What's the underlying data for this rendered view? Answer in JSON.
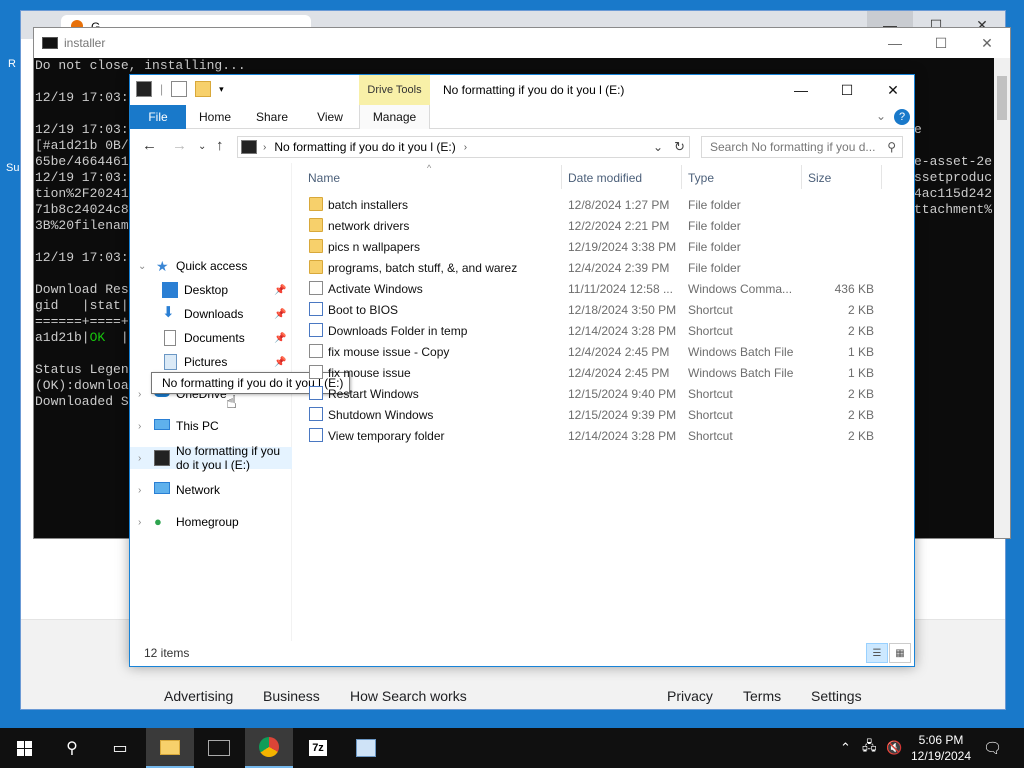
{
  "desktop": {
    "left_letters": [
      "R",
      "S",
      "I",
      "Su"
    ]
  },
  "browser": {
    "tab_title": "G",
    "footer_links_left": [
      "Advertising",
      "Business",
      "How Search works"
    ],
    "footer_links_right": [
      "Privacy",
      "Terms",
      "Settings"
    ]
  },
  "console": {
    "title": "installer",
    "lines": [
      "Do not close, installing...",
      "",
      "12/19 17:03:",
      "",
      "12/19 17:03:",
      "[#a1d21b 0B/",
      "65be/4664461",
      "12/19 17:03:",
      "tion%2F20241",
      "71b8c24024c8",
      "3B%20filenam",
      "",
      "12/19 17:03:",
      "",
      "Download Res",
      "gid   |stat|",
      "======+====+",
      "a1d21b|OK  |",
      "",
      "Status Legen",
      "(OK):downloa",
      "Downloaded S"
    ],
    "right_lines": [
      "",
      "",
      "",
      "",
      "e",
      "",
      "e-asset-2e",
      "ssetproduc",
      "4ac115d242",
      "ttachment%"
    ]
  },
  "explorer": {
    "title": "No formatting if you do it you l (E:)",
    "drive_tools": "Drive Tools",
    "ribbon_tabs": [
      "File",
      "Home",
      "Share",
      "View",
      "Manage"
    ],
    "address_crumb": "No formatting if you do it you l (E:)",
    "search_placeholder": "Search No formatting if you d...",
    "nav": {
      "quick_access": "Quick access",
      "quick_items": [
        "Desktop",
        "Downloads",
        "Documents",
        "Pictures"
      ],
      "onedrive": "OneDrive",
      "this_pc": "This PC",
      "drive": "No formatting if you do it you l (E:)",
      "network": "Network",
      "homegroup": "Homegroup"
    },
    "tooltip": "No formatting if you do it you l (E:)",
    "columns": [
      "Name",
      "Date modified",
      "Type",
      "Size"
    ],
    "files": [
      {
        "name": "batch installers",
        "date": "12/8/2024 1:27 PM",
        "type": "File folder",
        "size": "",
        "kind": "folder"
      },
      {
        "name": "network drivers",
        "date": "12/2/2024 2:21 PM",
        "type": "File folder",
        "size": "",
        "kind": "folder"
      },
      {
        "name": "pics n wallpapers",
        "date": "12/19/2024 3:38 PM",
        "type": "File folder",
        "size": "",
        "kind": "folder"
      },
      {
        "name": "programs, batch stuff, &, and warez",
        "date": "12/4/2024 2:39 PM",
        "type": "File folder",
        "size": "",
        "kind": "folder"
      },
      {
        "name": "Activate Windows",
        "date": "11/11/2024 12:58 ...",
        "type": "Windows Comma...",
        "size": "436 KB",
        "kind": "file"
      },
      {
        "name": "Boot to BIOS",
        "date": "12/18/2024 3:50 PM",
        "type": "Shortcut",
        "size": "2 KB",
        "kind": "shortcut"
      },
      {
        "name": "Downloads Folder in temp",
        "date": "12/14/2024 3:28 PM",
        "type": "Shortcut",
        "size": "2 KB",
        "kind": "shortcut"
      },
      {
        "name": "fix mouse issue - Copy",
        "date": "12/4/2024 2:45 PM",
        "type": "Windows Batch File",
        "size": "1 KB",
        "kind": "file"
      },
      {
        "name": "fix mouse issue",
        "date": "12/4/2024 2:45 PM",
        "type": "Windows Batch File",
        "size": "1 KB",
        "kind": "file"
      },
      {
        "name": "Restart Windows",
        "date": "12/15/2024 9:40 PM",
        "type": "Shortcut",
        "size": "2 KB",
        "kind": "shortcut"
      },
      {
        "name": "Shutdown Windows",
        "date": "12/15/2024 9:39 PM",
        "type": "Shortcut",
        "size": "2 KB",
        "kind": "shortcut"
      },
      {
        "name": "View temporary folder",
        "date": "12/14/2024 3:28 PM",
        "type": "Shortcut",
        "size": "2 KB",
        "kind": "shortcut"
      }
    ],
    "status_count": "12 items"
  },
  "taskbar": {
    "time": "5:06 PM",
    "date": "12/19/2024",
    "app_7z": "7z"
  },
  "colors": {
    "accent": "#1979ca",
    "console_bg": "#0c0c0c",
    "ok_green": "#16c60c",
    "drive_tools_bg": "#f8f0a8"
  }
}
